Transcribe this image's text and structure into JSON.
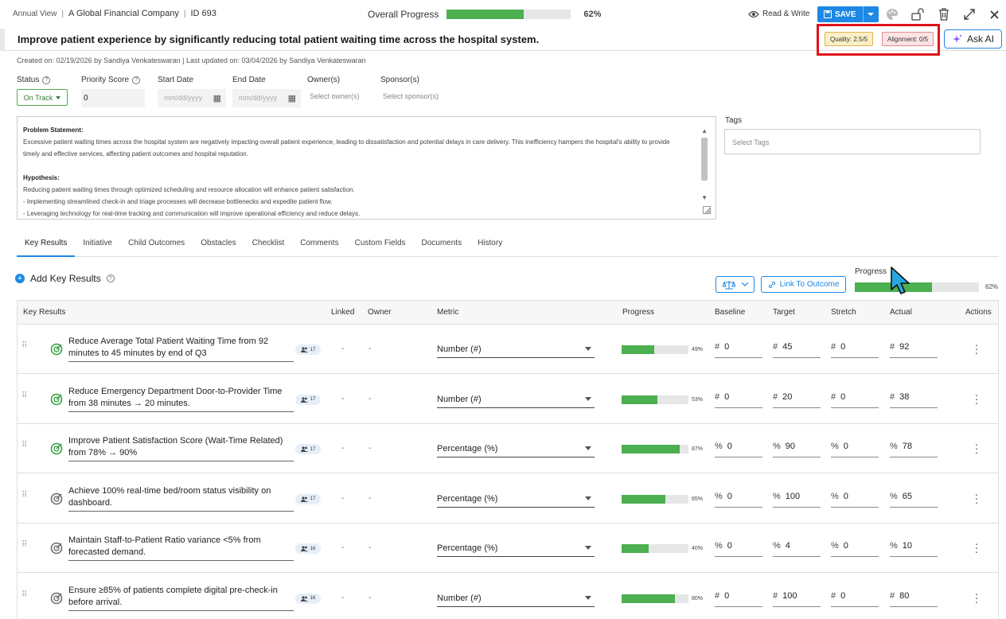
{
  "topbar": {
    "view": "Annual View",
    "company": "A Global Financial Company",
    "id_label": "ID 693",
    "overall_label": "Overall Progress",
    "overall_pct_text": "62%",
    "overall_value": 62,
    "read_write": "Read & Write",
    "save": "SAVE"
  },
  "title": "Improve patient experience by significantly reducing total patient waiting time across the hospital system.",
  "badges": {
    "quality": "Quality: 2.5/5",
    "alignment": "Alignment: 0/5"
  },
  "ask_ai": "Ask AI",
  "meta": "Created on: 02/19/2026 by Sandiya Venkateswaran  |  Last updated on: 03/04/2026 by Sandiya Venkateswaran",
  "fields": {
    "status_label": "Status",
    "status_value": "On Track",
    "priority_label": "Priority Score",
    "priority_value": "0",
    "start_label": "Start Date",
    "start_placeholder": "mm/dd/yyyy",
    "end_label": "End Date",
    "end_placeholder": "mm/dd/yyyy",
    "owner_label": "Owner(s)",
    "owner_placeholder": "Select owner(s)",
    "sponsor_label": "Sponsor(s)",
    "sponsor_placeholder": "Select sponsor(s)"
  },
  "problem": {
    "ps_heading": "Problem Statement",
    "ps_text": "Excessive patient waiting times across the hospital system are negatively impacting overall patient experience, leading to dissatisfaction and potential delays in care delivery. This inefficiency hampers the hospital's ability to provide timely and effective services, affecting patient outcomes and hospital reputation.",
    "hyp_heading": "Hypothesis",
    "hyp_line1": "Reducing patient waiting times through optimized scheduling and resource allocation will enhance patient satisfaction.",
    "hyp_line2": "- Implementing streamlined check-in and triage processes will decrease bottlenecks and expedite patient flow.",
    "hyp_line3": "- Leveraging technology for real-time tracking and communication will improve operational efficiency and reduce delays."
  },
  "tags": {
    "label": "Tags",
    "placeholder": "Select Tags"
  },
  "tabs": [
    "Key Results",
    "Initiative",
    "Child Outcomes",
    "Obstacles",
    "Checklist",
    "Comments",
    "Custom Fields",
    "Documents",
    "History"
  ],
  "kr_section": {
    "add_label": "Add Key Results",
    "link_label": "Link To Outcome",
    "progress_label": "Progress",
    "progress_pct_text": "62%",
    "progress_value": 62
  },
  "table": {
    "headers": [
      "Key Results",
      "Linked",
      "Owner",
      "Metric",
      "Progress",
      "Baseline",
      "Target",
      "Stretch",
      "Actual",
      "Actions"
    ],
    "rows": [
      {
        "text": "Reduce Average Total Patient Waiting Time from 92 minutes to  45 minutes by end of Q3",
        "chip": "17",
        "linked": "-",
        "owner": "-",
        "metric": "Number (#)",
        "progress": 49,
        "pct_text": "49%",
        "unit": "#",
        "baseline": "0",
        "target": "45",
        "stretch": "0",
        "actual": "92",
        "status": "green"
      },
      {
        "text": "Reduce Emergency Department Door-to-Provider Time from 38 minutes → 20 minutes.",
        "chip": "17",
        "linked": "-",
        "owner": "-",
        "metric": "Number (#)",
        "progress": 53,
        "pct_text": "53%",
        "unit": "#",
        "baseline": "0",
        "target": "20",
        "stretch": "0",
        "actual": "38",
        "status": "green"
      },
      {
        "text": "Improve Patient Satisfaction Score (Wait-Time Related) from 78% → 90%",
        "chip": "17",
        "linked": "-",
        "owner": "-",
        "metric": "Percentage (%)",
        "progress": 87,
        "pct_text": "87%",
        "unit": "%",
        "baseline": "0",
        "target": "90",
        "stretch": "0",
        "actual": "78",
        "status": "green"
      },
      {
        "text": "Achieve 100% real-time bed/room status visibility on dashboard.",
        "chip": "17",
        "linked": "-",
        "owner": "-",
        "metric": "Percentage (%)",
        "progress": 65,
        "pct_text": "65%",
        "unit": "%",
        "baseline": "0",
        "target": "100",
        "stretch": "0",
        "actual": "65",
        "status": "grey"
      },
      {
        "text": "Maintain Staff-to-Patient Ratio variance <5% from forecasted demand.",
        "chip": "16",
        "linked": "-",
        "owner": "-",
        "metric": "Percentage (%)",
        "progress": 40,
        "pct_text": "40%",
        "unit": "%",
        "baseline": "0",
        "target": "4",
        "stretch": "0",
        "actual": "10",
        "status": "grey"
      },
      {
        "text": "Ensure ≥85% of patients complete digital pre-check-in before arrival.",
        "chip": "16",
        "linked": "-",
        "owner": "-",
        "metric": "Number (#)",
        "progress": 80,
        "pct_text": "80%",
        "unit": "#",
        "baseline": "0",
        "target": "100",
        "stretch": "0",
        "actual": "80",
        "status": "grey"
      }
    ]
  },
  "colors": {
    "accent": "#1e88e5",
    "progress": "#4caf50",
    "highlight": "#e0101a"
  }
}
